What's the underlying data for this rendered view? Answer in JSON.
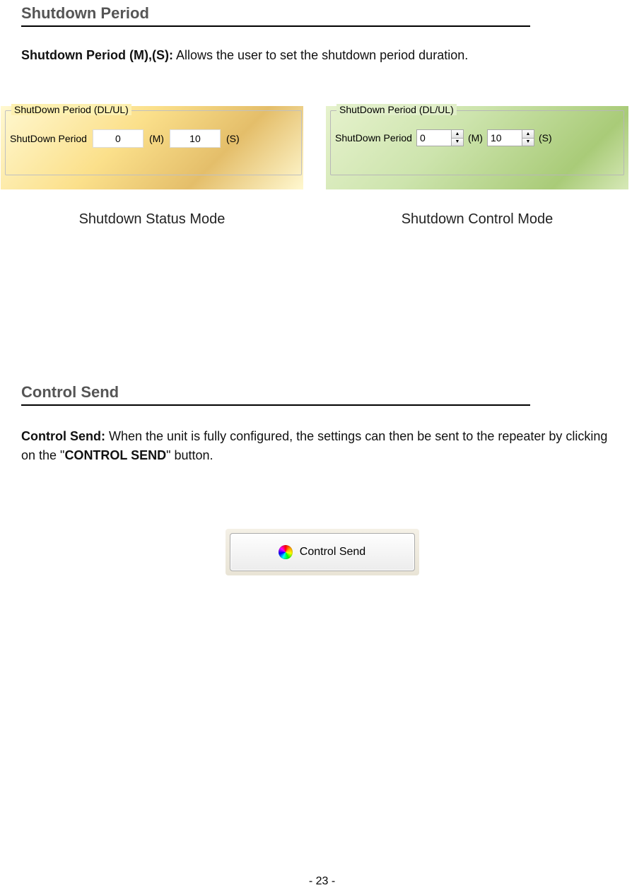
{
  "section1": {
    "title": "Shutdown Period",
    "desc_label": "Shutdown Period (M),(S):",
    "desc_text": " Allows the user to set the shutdown period duration."
  },
  "status_fig": {
    "group_label": "ShutDown Period (DL/UL)",
    "row_label": "ShutDown Period",
    "val_m": "0",
    "unit_m": "(M)",
    "val_s": "10",
    "unit_s": "(S)",
    "caption": "Shutdown Status Mode"
  },
  "ctrl_fig": {
    "group_label": "ShutDown Period (DL/UL)",
    "row_label": "ShutDown Period",
    "val_m": "0",
    "unit_m": "(M)",
    "val_s": "10",
    "unit_s": "(S)",
    "caption": "Shutdown Control Mode"
  },
  "section2": {
    "title": "Control Send",
    "desc_label": "Control Send:",
    "desc_text_a": " When the unit is fully configured, the settings can then be sent to the repeater by clicking on the \"",
    "desc_bold": "CONTROL SEND",
    "desc_text_b": "\" button."
  },
  "cs_button": {
    "label": "Control Send"
  },
  "page_number": "- 23 -"
}
